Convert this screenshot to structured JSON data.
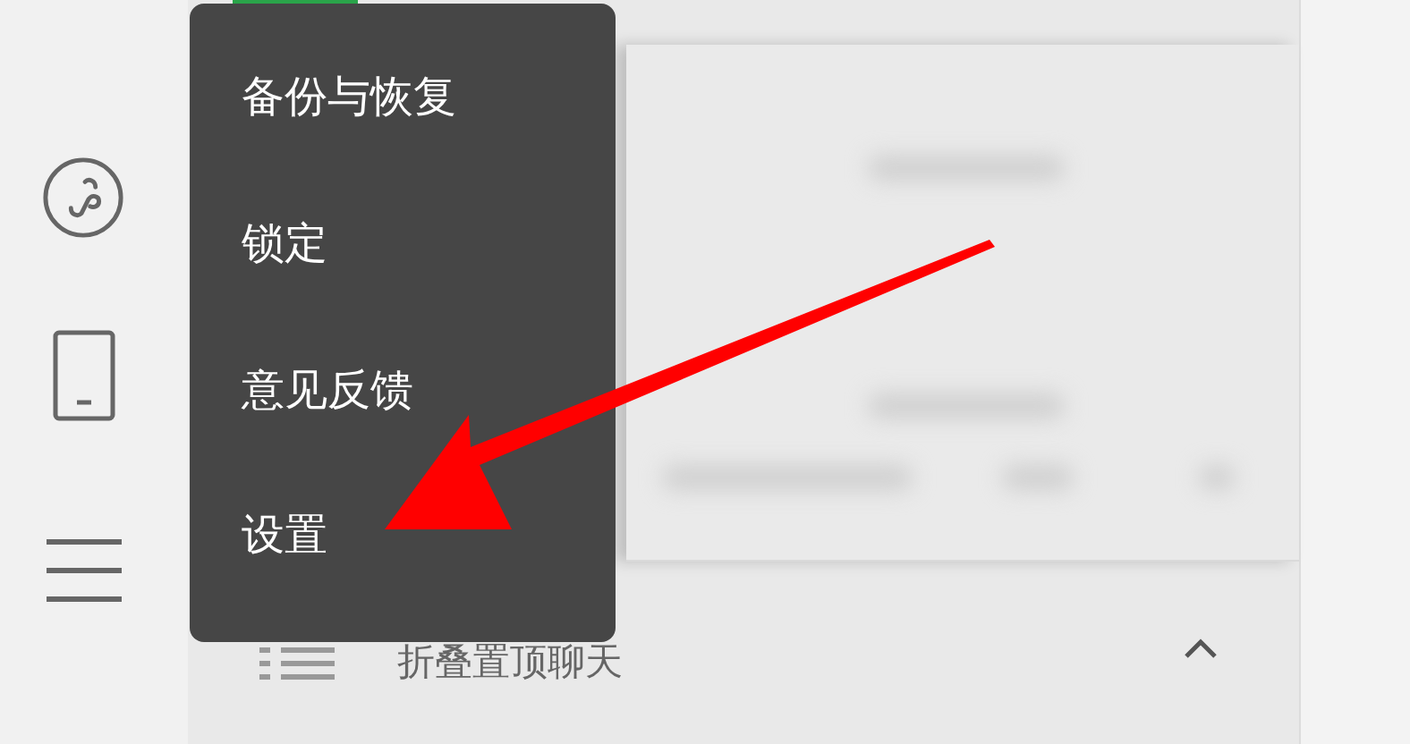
{
  "menu": {
    "items": [
      {
        "label": "备份与恢复"
      },
      {
        "label": "锁定"
      },
      {
        "label": "意见反馈"
      },
      {
        "label": "设置"
      }
    ]
  },
  "chat_list": {
    "collapse_row": {
      "label": "折叠置顶聊天"
    }
  }
}
